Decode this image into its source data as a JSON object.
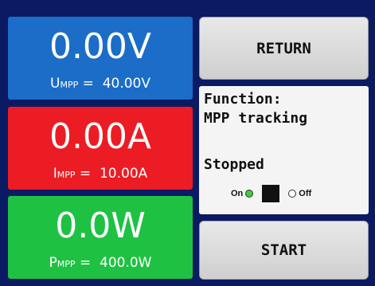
{
  "voltage": {
    "value": "0.00V",
    "set_label_main": "U",
    "set_label_sub": "MPP",
    "set_eq": "=",
    "set_value": "40.00V",
    "color": "#1b6dc8"
  },
  "current": {
    "value": "0.00A",
    "set_label_main": "I",
    "set_label_sub": "MPP",
    "set_eq": "=",
    "set_value": "10.00A",
    "color": "#ec1c24"
  },
  "power": {
    "value": "0.0W",
    "set_label_main": "P",
    "set_label_sub": "MPP",
    "set_eq": "=",
    "set_value": "400.0W",
    "color": "#1fc143"
  },
  "buttons": {
    "return_label": "RETURN",
    "start_label": "START"
  },
  "info": {
    "function_label": "Function:",
    "function_value": "MPP tracking",
    "status": "Stopped",
    "radio_on_label": "On",
    "radio_off_label": "Off",
    "selected": "On"
  }
}
